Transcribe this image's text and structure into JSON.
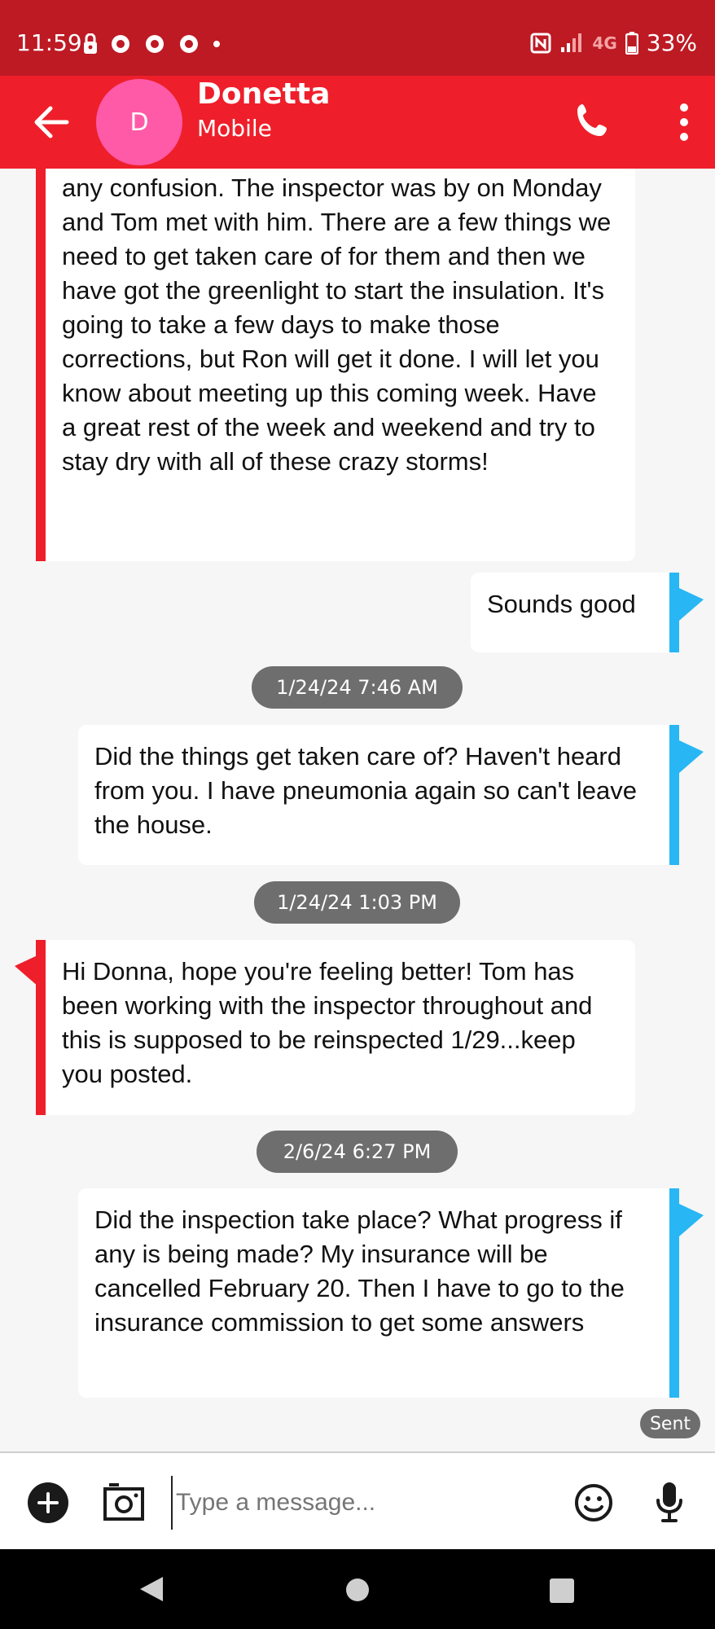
{
  "status_bar": {
    "time": "11:59",
    "battery": "33%",
    "network": "4G"
  },
  "contact": {
    "initial": "D",
    "name": "Donetta",
    "type": "Mobile"
  },
  "messages": [
    {
      "dir": "in",
      "text": "any confusion. The inspector was by on Monday and Tom met with him. There are a few things we need to get taken care of for them and then we have got the greenlight to start the insulation. It's going to take a few days to make those corrections, but Ron will get it done. I will let you know about meeting up this coming week. Have a great rest of the week and weekend and try to stay dry with all of these crazy storms!"
    },
    {
      "dir": "out",
      "text": "Sounds good"
    },
    {
      "stamp": "1/24/24 7:46 AM"
    },
    {
      "dir": "out",
      "text": "Did the things get taken care of?  Haven't heard from you.  I have pneumonia again so can't leave the house."
    },
    {
      "stamp": "1/24/24 1:03 PM"
    },
    {
      "dir": "in",
      "text": "Hi Donna, hope you're feeling better! Tom has been working with the inspector throughout and this is supposed to be reinspected 1/29...keep you posted."
    },
    {
      "stamp": "2/6/24 6:27 PM"
    },
    {
      "dir": "out",
      "text": "Did the inspection take place?  What progress if any is being made?  My insurance will be cancelled February 20.  Then I have to go to the insurance commission to get some answers"
    }
  ],
  "sent_label": "Sent",
  "composer": {
    "placeholder": "Type a message..."
  },
  "colors": {
    "status_bar": "#bd1a24",
    "app_bar": "#ee1f2a",
    "incoming_accent": "#ee1f2a",
    "outgoing_accent": "#28b7f4",
    "avatar": "#ff5aa8"
  }
}
